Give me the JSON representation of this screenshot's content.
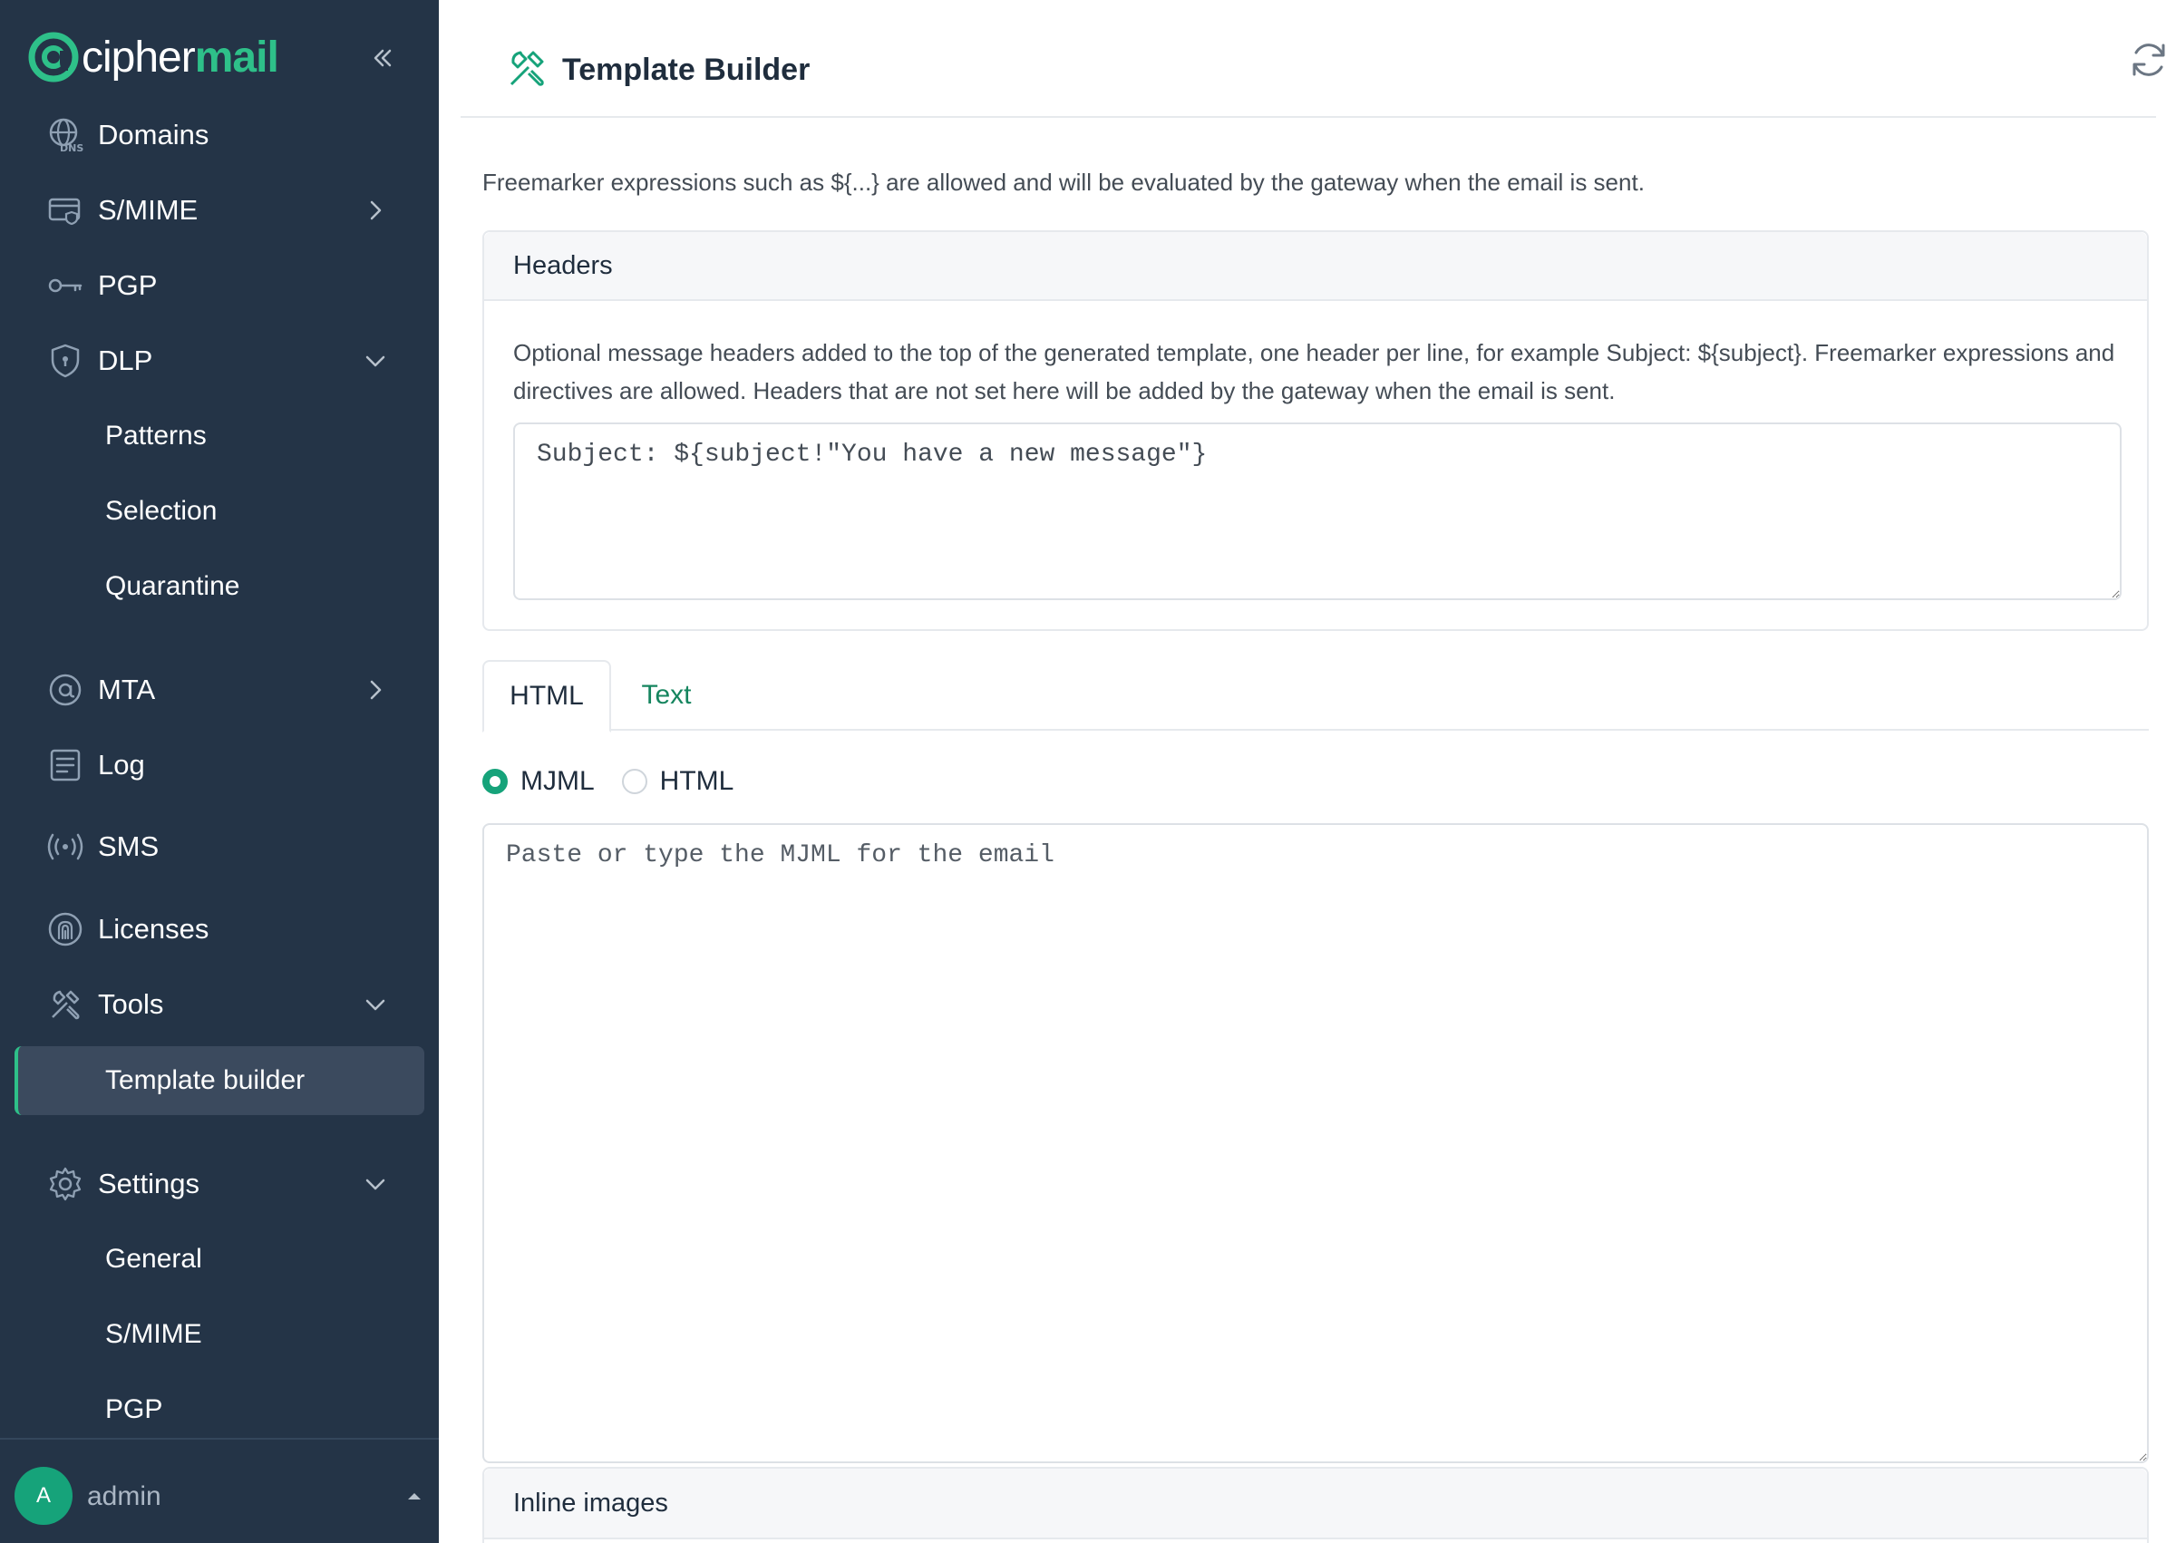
{
  "brand": {
    "logo_word_light": "cipher",
    "logo_word_accent": "mail",
    "accent_color": "#2ec089",
    "sidebar_bg": "#243447"
  },
  "sidebar": {
    "items": [
      {
        "label": "Domains",
        "icon": "dns-globe-icon"
      },
      {
        "label": "S/MIME",
        "icon": "smime-card-icon",
        "chevron": "right"
      },
      {
        "label": "PGP",
        "icon": "key-icon"
      },
      {
        "label": "DLP",
        "icon": "shield-icon",
        "chevron": "down"
      },
      {
        "label": "MTA",
        "icon": "at-sign-icon",
        "chevron": "right"
      },
      {
        "label": "Log",
        "icon": "log-document-icon"
      },
      {
        "label": "SMS",
        "icon": "broadcast-icon"
      },
      {
        "label": "Licenses",
        "icon": "fingerprint-icon"
      },
      {
        "label": "Tools",
        "icon": "tools-icon",
        "chevron": "down"
      },
      {
        "label": "Settings",
        "icon": "gear-icon",
        "chevron": "down"
      }
    ],
    "dlp_sub": [
      "Patterns",
      "Selection",
      "Quarantine"
    ],
    "tools_sub": [
      "Template builder"
    ],
    "settings_sub": [
      "General",
      "S/MIME",
      "PGP"
    ],
    "user": {
      "initial": "A",
      "name": "admin"
    }
  },
  "page": {
    "title": "Template Builder",
    "intro": "Freemarker expressions such as ${...} are allowed and will be evaluated by the gateway when the email is sent.",
    "headers_card": {
      "title": "Headers",
      "description": "Optional message headers added to the top of the generated template, one header per line, for example Subject: ${subject}. Freemarker expressions and directives are allowed. Headers that are not set here will be added by the gateway when the email is sent.",
      "value": "Subject: ${subject!\"You have a new message\"}"
    },
    "tabs": [
      {
        "label": "HTML",
        "active": true
      },
      {
        "label": "Text",
        "active": false
      }
    ],
    "format_options": [
      {
        "label": "MJML",
        "checked": true
      },
      {
        "label": "HTML",
        "checked": false
      }
    ],
    "mjml_placeholder": "Paste or type the MJML for the email",
    "inline_images_title": "Inline images"
  }
}
